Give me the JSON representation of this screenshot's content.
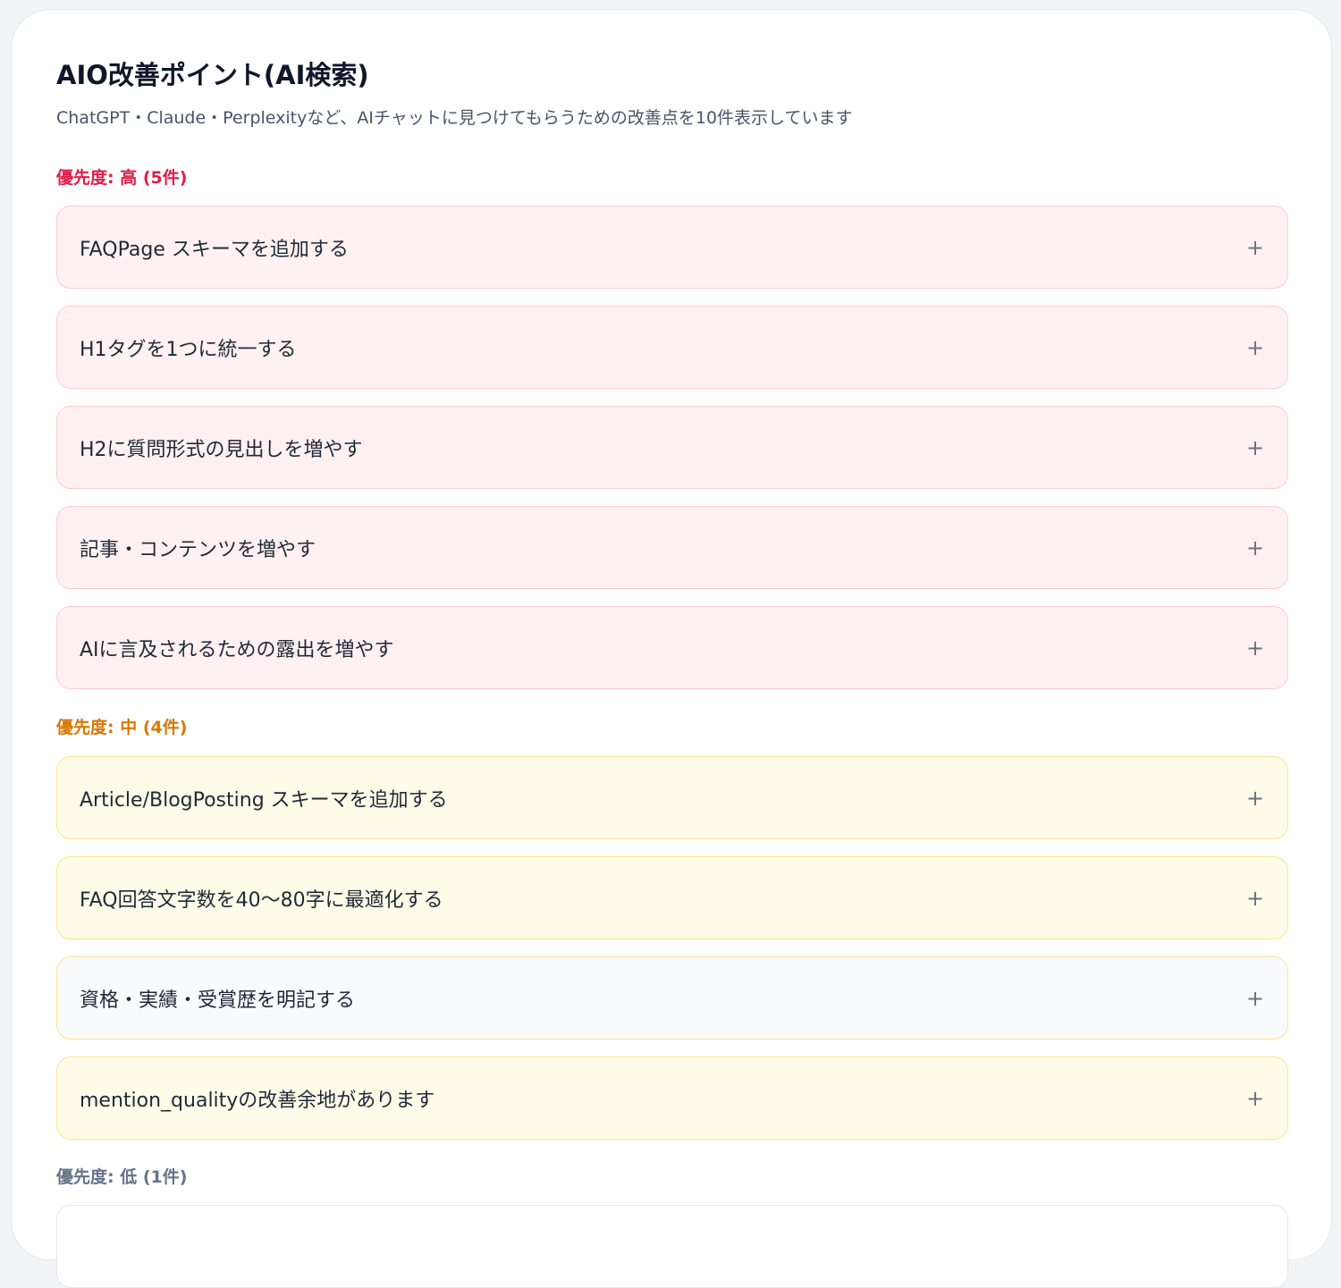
{
  "panel": {
    "title": "AIO改善ポイント(AI検索)",
    "subtitle": "ChatGPT・Claude・Perplexityなど、AIチャットに見つけてもらうための改善点を10件表示しています"
  },
  "groups": [
    {
      "heading": "優先度: 高 (5件)",
      "color": "#e11d48",
      "items": [
        {
          "label": "FAQPage スキーマを追加する"
        },
        {
          "label": "H1タグを1つに統一する"
        },
        {
          "label": "H2に質問形式の見出しを増やす"
        },
        {
          "label": "記事・コンテンツを増やす"
        },
        {
          "label": "AIに言及されるための露出を増やす"
        }
      ]
    },
    {
      "heading": "優先度: 中 (4件)",
      "color": "#d97706",
      "items": [
        {
          "label": "Article/BlogPosting スキーマを追加する"
        },
        {
          "label": "FAQ回答文字数を40〜80字に最適化する"
        },
        {
          "label": "資格・実績・受賞歴を明記する"
        },
        {
          "label": "mention_qualityの改善余地があります"
        }
      ]
    },
    {
      "heading": "優先度: 低 (1件)",
      "color": "#64748b",
      "items": []
    }
  ],
  "icons": {
    "expand": "plus-icon",
    "expand_glyph": "+"
  },
  "colors": {
    "high_bg": "#fff1f2",
    "high_border": "#fecdd3",
    "medium_bg": "#fefbe8",
    "medium_border": "#fde68a",
    "neutral_bg": "#f8fafc"
  }
}
